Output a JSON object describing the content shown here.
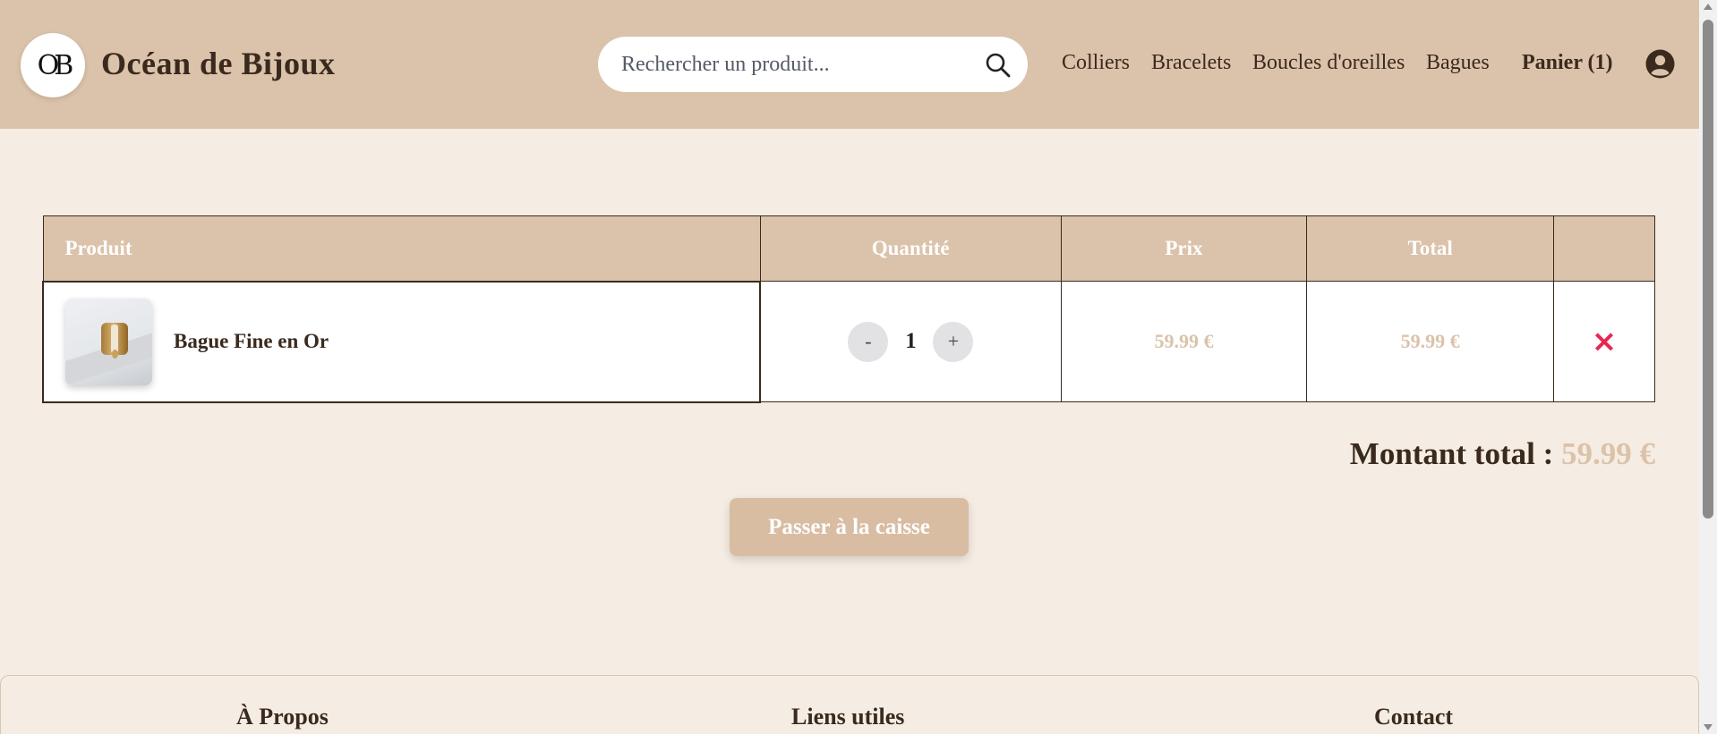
{
  "header": {
    "logo_text": "OB",
    "brand": "Océan de Bijoux",
    "search": {
      "placeholder": "Rechercher un produit...",
      "value": ""
    },
    "nav": [
      "Colliers",
      "Bracelets",
      "Boucles d'oreilles",
      "Bagues"
    ],
    "cart_label": "Panier (1)"
  },
  "cart": {
    "columns": {
      "product": "Produit",
      "quantity": "Quantité",
      "price": "Prix",
      "total": "Total"
    },
    "items": [
      {
        "name": "Bague Fine en Or",
        "quantity": "1",
        "price": "59.99 €",
        "total": "59.99 €"
      }
    ],
    "qty_minus": "-",
    "qty_plus": "+",
    "remove_icon": "×",
    "grand_total_label": "Montant total :",
    "grand_total_value": "59.99 €",
    "checkout_label": "Passer à la caisse"
  },
  "footer": {
    "about": "À Propos",
    "links": "Liens utiles",
    "contact": "Contact"
  },
  "colors": {
    "header_bg": "#dbc2aa",
    "page_bg": "#f5ede3",
    "text": "#3a2a1e",
    "price": "#dbc2aa",
    "remove": "#e8264f"
  }
}
